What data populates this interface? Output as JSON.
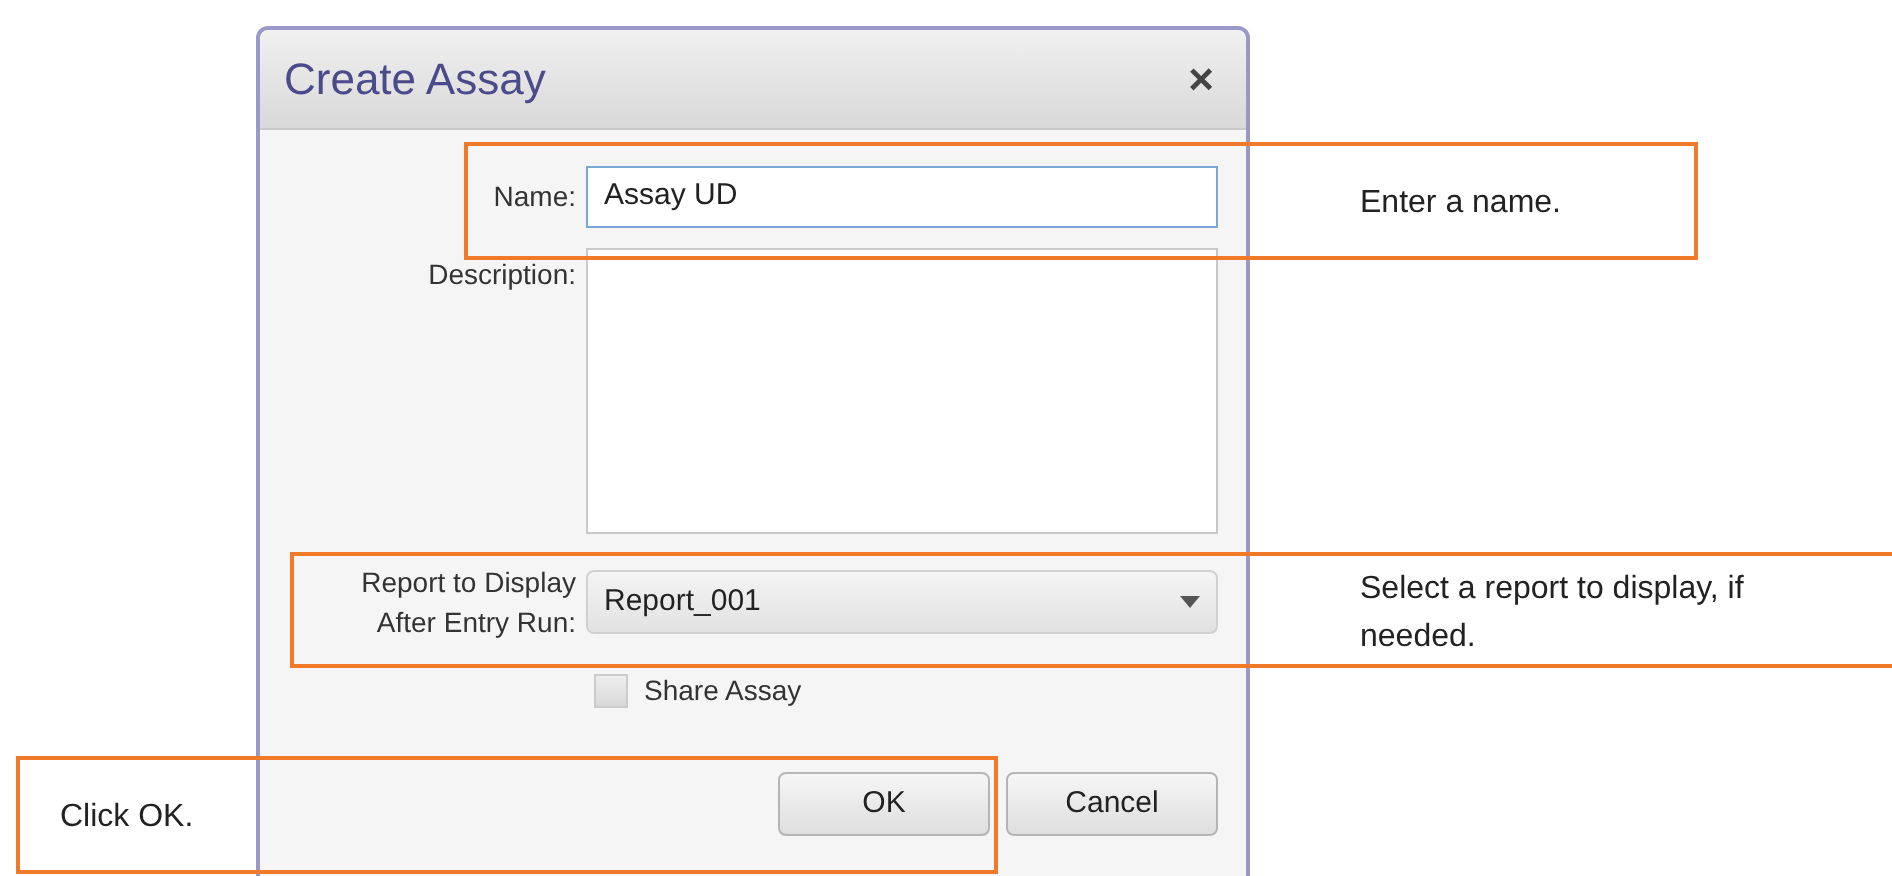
{
  "dialog": {
    "title": "Create Assay",
    "close": "×",
    "name_field": {
      "label": "Name:",
      "value": "Assay UD"
    },
    "description_field": {
      "label": "Description:"
    },
    "report_field": {
      "label": "Report to Display After Entry Run:",
      "value": "Report_001"
    },
    "share_checkbox": {
      "label": "Share Assay",
      "checked": false
    },
    "buttons": [
      "OK",
      "Cancel"
    ]
  },
  "callouts": [
    {
      "text": "Enter a name."
    },
    {
      "text": "Select a report to display, if needed."
    },
    {
      "text": "Click OK."
    }
  ]
}
